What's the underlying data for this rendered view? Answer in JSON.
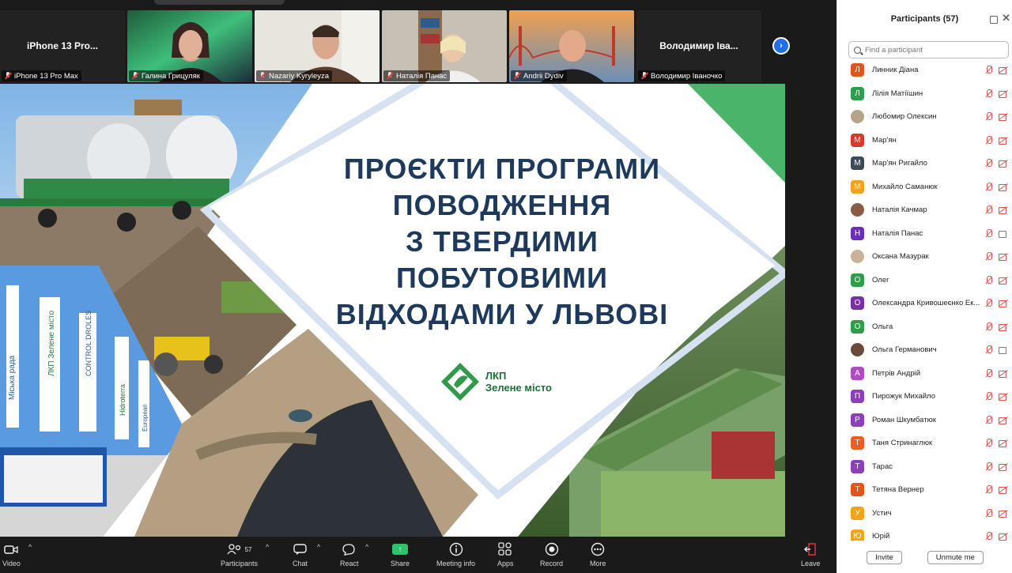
{
  "video_strip": {
    "tiles": [
      {
        "center_name": "iPhone 13 Pro...",
        "label": "iPhone 13 Pro Max",
        "muted": true
      },
      {
        "center_name": "",
        "label": "Галина Грицуляк",
        "muted": true
      },
      {
        "center_name": "",
        "label": "Nazariy Kyryleyza",
        "muted": true,
        "active": true
      },
      {
        "center_name": "",
        "label": "Наталія Панас",
        "muted": true
      },
      {
        "center_name": "",
        "label": "Andrii Dydiv",
        "muted": true
      },
      {
        "center_name": "Володимир Іва...",
        "label": "Володимир Іваночко",
        "muted": true
      }
    ]
  },
  "slide": {
    "title_lines": [
      "ПРОЄКТИ ПРОГРАМИ",
      "ПОВОДЖЕННЯ",
      "З ТВЕРДИМИ",
      "ПОБУТОВИМИ",
      "ВІДХОДАМИ У ЛЬВОВІ"
    ],
    "logo_line1": "ЛКП",
    "logo_line2": "Зелене місто",
    "flag_texts": [
      "Міська рада",
      "ЛКП Зелене місто",
      "CONTROL DROLES",
      "Hidroterra",
      "European"
    ]
  },
  "toolbar": {
    "video": "Video",
    "participants": "Participants",
    "participants_count": "57",
    "chat": "Chat",
    "react": "React",
    "share": "Share",
    "meeting_info": "Meeting info",
    "apps": "Apps",
    "record": "Record",
    "more": "More",
    "leave": "Leave"
  },
  "panel": {
    "title": "Participants (57)",
    "search_placeholder": "Find a participant",
    "invite": "Invite",
    "unmute_me": "Unmute me",
    "participants": [
      {
        "initial": "Л",
        "color": "#e0551b",
        "name": "Линник Діана",
        "cam_on": false
      },
      {
        "initial": "Л",
        "color": "#2e9e4a",
        "name": "Лілія Матіїшин",
        "cam_on": false
      },
      {
        "initial": "",
        "color": "#b7a48a",
        "name": "Любомир Олексин",
        "photo": true,
        "cam_on": false
      },
      {
        "initial": "М",
        "color": "#d13d2a",
        "name": "Мар'ян",
        "cam_on": false
      },
      {
        "initial": "М",
        "color": "#3c4a5a",
        "name": "Мар'ян Ригайло",
        "cam_on": false
      },
      {
        "initial": "М",
        "color": "#f0a31b",
        "name": "Михайло Саманюк",
        "cam_on": false
      },
      {
        "initial": "",
        "color": "#8a5a44",
        "name": "Наталія Качмар",
        "photo": true,
        "cam_on": false
      },
      {
        "initial": "Н",
        "color": "#6a2fb8",
        "name": "Наталія Панас",
        "cam_on": true
      },
      {
        "initial": "",
        "color": "#c9b29a",
        "name": "Оксана Мазурак",
        "photo": true,
        "cam_on": false
      },
      {
        "initial": "О",
        "color": "#2e9e4a",
        "name": "Олег",
        "cam_on": false
      },
      {
        "initial": "О",
        "color": "#7a2fa8",
        "name": "Олександра Кривошеєнко Ек...",
        "cam_on": false
      },
      {
        "initial": "О",
        "color": "#2e9e4a",
        "name": "Ольга",
        "cam_on": false
      },
      {
        "initial": "",
        "color": "#6a4a3a",
        "name": "Ольга Германович",
        "photo": true,
        "cam_on": true
      },
      {
        "initial": "А",
        "color": "#b04bc4",
        "name": "Петрів Андрій",
        "cam_on": false
      },
      {
        "initial": "П",
        "color": "#8e3dbb",
        "name": "Пирожук Михайло",
        "cam_on": false
      },
      {
        "initial": "Р",
        "color": "#8e3dbb",
        "name": "Роман Шкумбатюк",
        "cam_on": false
      },
      {
        "initial": "Т",
        "color": "#e8601f",
        "name": "Таня Стринаглюк",
        "cam_on": false
      },
      {
        "initial": "Т",
        "color": "#8e3dbb",
        "name": "Тарас",
        "cam_on": false
      },
      {
        "initial": "Т",
        "color": "#e0551b",
        "name": "Тетяна Вернер",
        "cam_on": false
      },
      {
        "initial": "У",
        "color": "#f0a31b",
        "name": "Устич",
        "cam_on": false
      },
      {
        "initial": "Ю",
        "color": "#f0a31b",
        "name": "Юрій",
        "cam_on": false
      }
    ]
  }
}
